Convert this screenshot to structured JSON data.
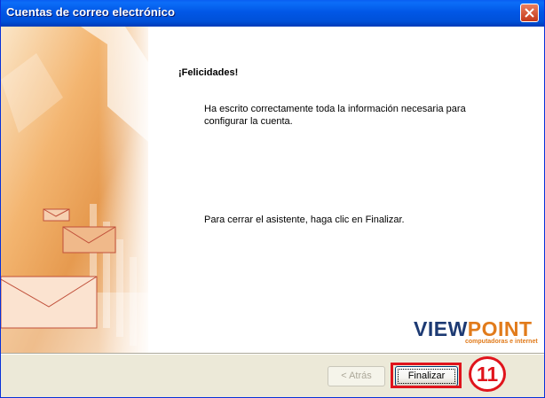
{
  "window": {
    "title": "Cuentas de correo electrónico"
  },
  "icons": {
    "close": "close-icon",
    "envelopes": "envelope-icon",
    "logo": "viewpoint-logo"
  },
  "colors": {
    "accent_orange": "#e17b1b",
    "brand_blue": "#1d3a73",
    "highlight_red": "#e0141c",
    "titlebar_blue": "#0054e3"
  },
  "wizard": {
    "heading": "¡Felicidades!",
    "message": "Ha escrito correctamente toda la información necesaria para configurar la cuenta.",
    "instruction": "Para cerrar el asistente, haga clic en Finalizar."
  },
  "logo": {
    "word_a": "VIEW",
    "word_b": "POINT",
    "tagline": "computadoras e internet"
  },
  "buttons": {
    "back": "< Atrás",
    "finish": "Finalizar"
  },
  "annotation": {
    "step": "11"
  }
}
